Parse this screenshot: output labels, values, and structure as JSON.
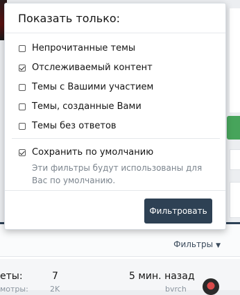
{
  "menu": {
    "title": "Показать только:",
    "options": [
      {
        "label": "Непрочитанные темы",
        "checked": false
      },
      {
        "label": "Отслеживаемый контент",
        "checked": true
      },
      {
        "label": "Темы с Вашими участием",
        "checked": false
      },
      {
        "label": "Темы, созданные Вами",
        "checked": false
      },
      {
        "label": "Темы без ответов",
        "checked": false
      }
    ],
    "save_default": {
      "label": "Сохранить по умолчанию",
      "checked": true,
      "hint": "Эти фильтры будут использованы для Вас по умолчанию."
    },
    "submit_label": "Фильтровать"
  },
  "background": {
    "filters_label": "Фильтры",
    "row": {
      "replies_label": "еты:",
      "replies_value": "7",
      "views_label": "мотры:",
      "views_value": "2K",
      "last_time": "5 мин. назад",
      "last_user": "bvrch"
    }
  },
  "colors": {
    "accent": "#2e4154",
    "success": "#47a45b",
    "muted": "#7b848d"
  }
}
